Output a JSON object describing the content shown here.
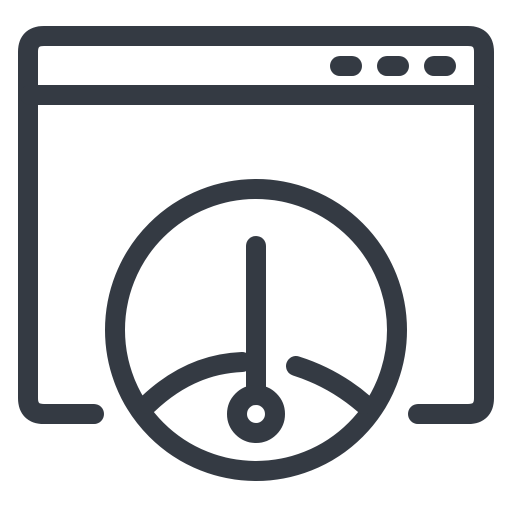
{
  "icon": {
    "name": "browser-window-speedometer-icon",
    "stroke_color": "#343a43",
    "background_color": "#ffffff"
  }
}
